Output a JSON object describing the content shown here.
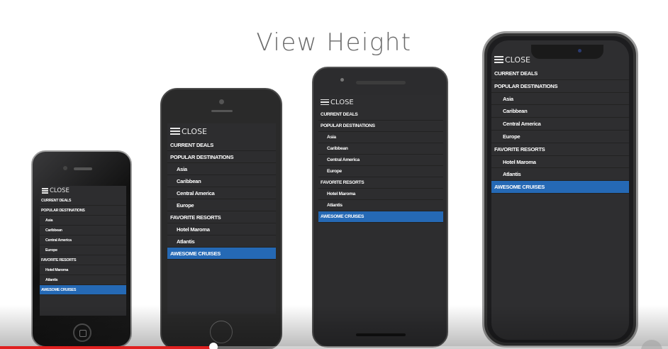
{
  "title": "View Height",
  "menu": {
    "close_label": "CLOSE",
    "items": [
      {
        "label": "CURRENT DEALS",
        "level": 0
      },
      {
        "label": "POPULAR DESTINATIONS",
        "level": 0
      },
      {
        "label": "Asia",
        "level": 1
      },
      {
        "label": "Caribbean",
        "level": 1
      },
      {
        "label": "Central America",
        "level": 1
      },
      {
        "label": "Europe",
        "level": 1
      },
      {
        "label": "FAVORITE RESORTS",
        "level": 0
      },
      {
        "label": "Hotel Maroma",
        "level": 1
      },
      {
        "label": "Atlantis",
        "level": 1
      },
      {
        "label": "AWESOME CRUISES",
        "level": 0,
        "active": true
      }
    ]
  },
  "colors": {
    "active": "#2569b5",
    "menu_bg": "#2d2d2f",
    "progress": "#e02020"
  },
  "video": {
    "progress_fraction": 0.32
  }
}
